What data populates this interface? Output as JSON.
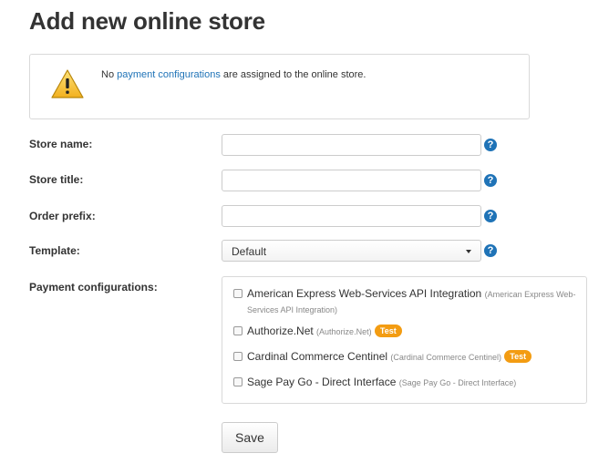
{
  "page": {
    "title": "Add new online store"
  },
  "alert": {
    "prefix": "No ",
    "link": "payment configurations",
    "suffix": " are assigned to the online store.",
    "icon": "warning-icon"
  },
  "form": {
    "store_name_label": "Store name:",
    "store_name_value": "",
    "store_title_label": "Store title:",
    "store_title_value": "",
    "order_prefix_label": "Order prefix:",
    "order_prefix_value": "",
    "template_label": "Template:",
    "template_value": "Default",
    "payment_label": "Payment configurations:",
    "help_glyph": "?"
  },
  "payments": [
    {
      "name": "American Express Web-Services API Integration",
      "sub_line1": "(American Express Web-",
      "sub_line2": "Services API Integration)",
      "badge": ""
    },
    {
      "name": "Authorize.Net",
      "sub": "(Authorize.Net)",
      "badge": "Test"
    },
    {
      "name": "Cardinal Commerce Centinel",
      "sub": "(Cardinal Commerce Centinel)",
      "badge": "Test"
    },
    {
      "name": "Sage Pay Go - Direct Interface",
      "sub": "(Sage Pay Go - Direct Interface)",
      "badge": ""
    }
  ],
  "actions": {
    "save_label": "Save"
  },
  "colors": {
    "link": "#1f73b7",
    "help": "#1f73b7",
    "badge": "#f39c12",
    "warning": "#f2b01e"
  }
}
